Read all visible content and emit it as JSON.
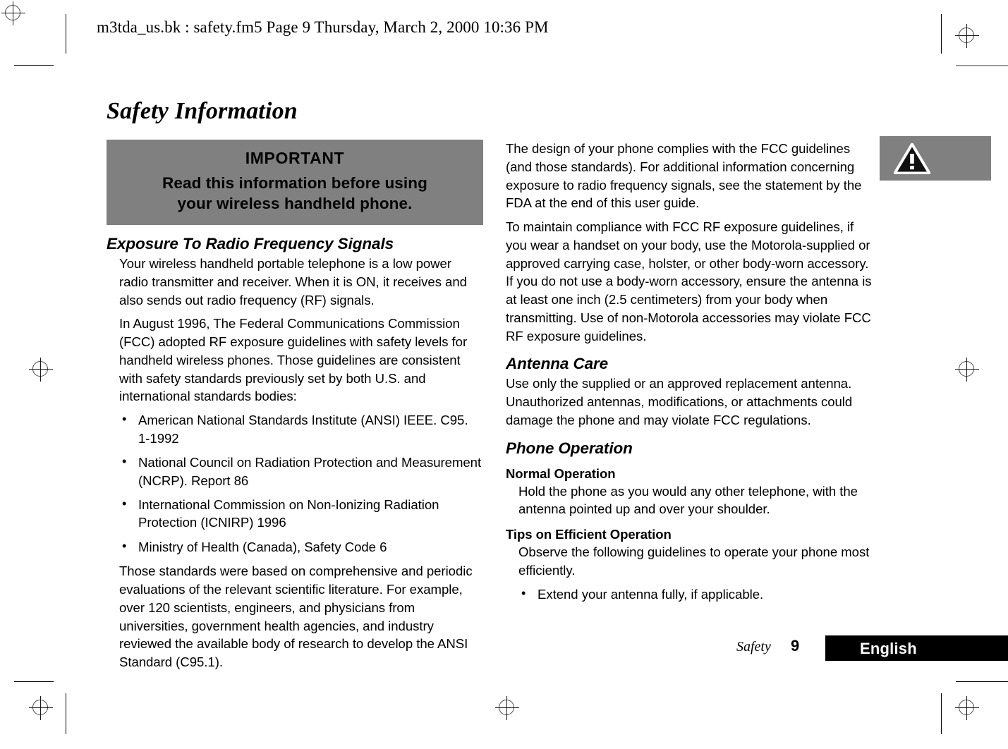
{
  "header": {
    "running_header": "m3tda_us.bk : safety.fm5  Page 9  Thursday, March 2, 2000  10:36 PM"
  },
  "page": {
    "title": "Safety Information"
  },
  "callout": {
    "title": "IMPORTANT",
    "line1": "Read this information before using",
    "line2": "your wireless handheld phone.",
    "background_color": "#808080"
  },
  "warning_tab": {
    "icon_name": "warning-triangle-icon",
    "background_color": "#808080"
  },
  "left_column": {
    "heading": "Exposure To Radio Frequency Signals",
    "para1": "Your wireless handheld portable telephone is a low power radio transmitter and receiver. When it is ON, it receives and also sends out radio frequency (RF) signals.",
    "para2": "In August 1996, The Federal Communications Commission (FCC) adopted RF exposure guidelines with safety levels for handheld wireless phones. Those guidelines are consistent with safety standards previously set by both U.S. and international standards bodies:",
    "bullets": [
      "American National Standards Institute (ANSI) IEEE. C95. 1-1992",
      "National Council on Radiation Protection and Measurement (NCRP). Report 86",
      "International Commission on Non-Ionizing Radiation Protection (ICNIRP) 1996",
      "Ministry of Health (Canada), Safety Code 6"
    ],
    "para3": "Those standards were based on comprehensive and periodic evaluations of the relevant scientific literature. For example, over 120 scientists, engineers, and physicians from universities, government health agencies, and industry reviewed the available body of research to develop the ANSI Standard (C95.1)."
  },
  "right_column": {
    "para1": "The design of your phone complies with the FCC guidelines (and those standards). For additional information concerning exposure to radio frequency signals, see the statement by the FDA at the end of this user guide.",
    "para2": "To maintain compliance with FCC RF exposure guidelines, if you wear a handset on your body, use the Motorola-supplied or approved carrying case, holster, or other body-worn accessory. If you do not use a body-worn accessory, ensure the antenna is at least one inch (2.5 centimeters) from your body when transmitting. Use of non-Motorola accessories may violate FCC RF exposure guidelines.",
    "antenna_heading": "Antenna Care",
    "antenna_para": "Use only the supplied or an approved replacement antenna. Unauthorized antennas, modifications, or attachments could damage the phone and may violate FCC regulations.",
    "phone_op_heading": "Phone Operation",
    "normal_op_heading": "Normal Operation",
    "normal_op_para": "Hold the phone as you would any other telephone, with the antenna pointed up and over your shoulder.",
    "tips_heading": "Tips on Efficient Operation",
    "tips_para": "Observe the following guidelines to operate your phone most efficiently.",
    "tips_bullets": [
      "Extend your antenna fully, if applicable."
    ]
  },
  "footer": {
    "section_label": "Safety",
    "page_number": "9",
    "language": "English",
    "language_bar_color": "#000000"
  }
}
